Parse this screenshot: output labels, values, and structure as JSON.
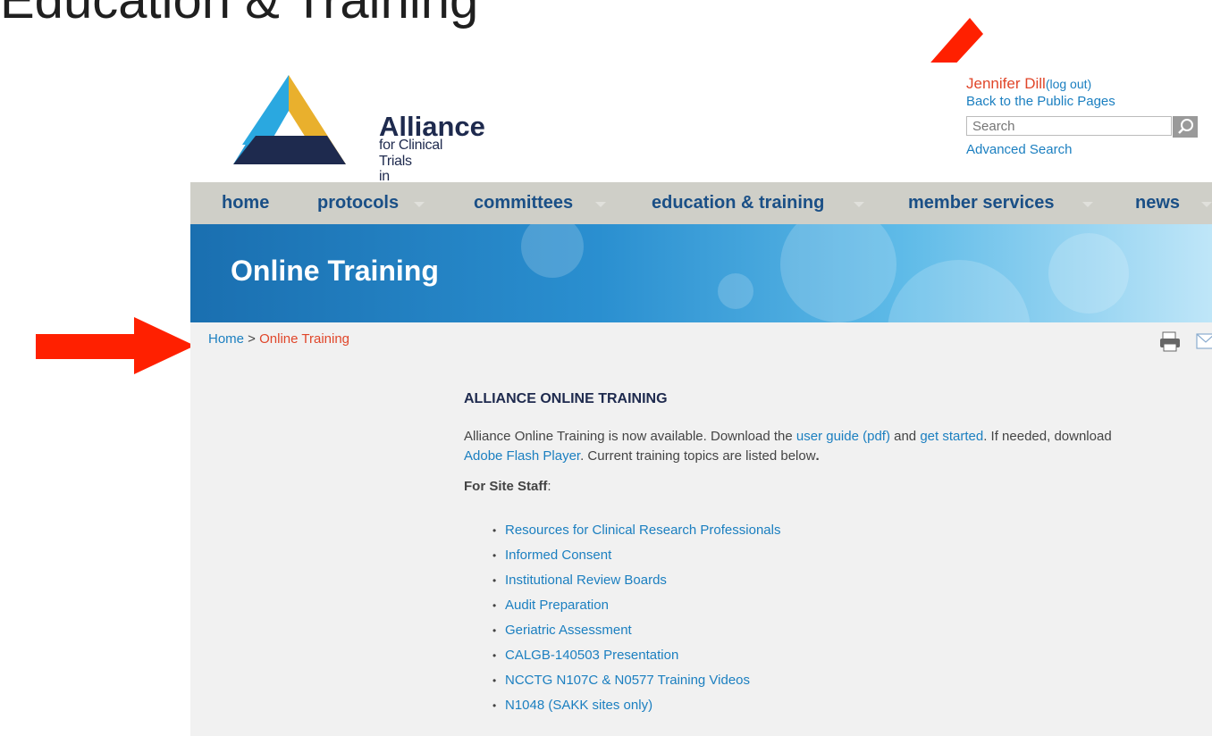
{
  "slide": {
    "title": "Education & Training"
  },
  "logo": {
    "name": "Alliance",
    "subtitle_line1": "for Clinical Trials",
    "subtitle_line2": "in Oncology"
  },
  "user": {
    "name": "Jennifer Dill",
    "logout_label": "(log out)",
    "back_link": "Back to the Public Pages",
    "search_placeholder": "Search",
    "advanced_search": "Advanced Search"
  },
  "nav": {
    "items": [
      {
        "label": "home"
      },
      {
        "label": "protocols"
      },
      {
        "label": "committees"
      },
      {
        "label": "education & training"
      },
      {
        "label": "member services"
      },
      {
        "label": "news"
      }
    ]
  },
  "banner": {
    "title": "Online Training"
  },
  "breadcrumb": {
    "home": "Home",
    "separator": " > ",
    "current": "Online Training"
  },
  "content": {
    "heading": "ALLIANCE ONLINE TRAINING",
    "intro_1": "Alliance Online Training is now available.  Download the ",
    "link_user_guide": "user guide (pdf)",
    "intro_2": " and ",
    "link_get_started": "get started",
    "intro_3": ". If needed, download ",
    "link_flash": "Adobe Flash Player",
    "intro_4": ".  Current training topics are listed below",
    "intro_5": ".",
    "staff_label": "For Site Staff",
    "staff_colon": ":",
    "topics": [
      "Resources for Clinical Research Professionals",
      "Informed Consent",
      "Institutional Review Boards",
      "Audit Preparation",
      "Geriatric Assessment",
      "CALGB-140503 Presentation",
      "NCCTG N107C & N0577 Training Videos",
      "N1048 (SAKK sites only)"
    ]
  },
  "colors": {
    "annotation_arrow": "#ff2000",
    "link": "#1b7fc0",
    "accent": "#e0462a",
    "nav_text": "#1a4f86"
  }
}
